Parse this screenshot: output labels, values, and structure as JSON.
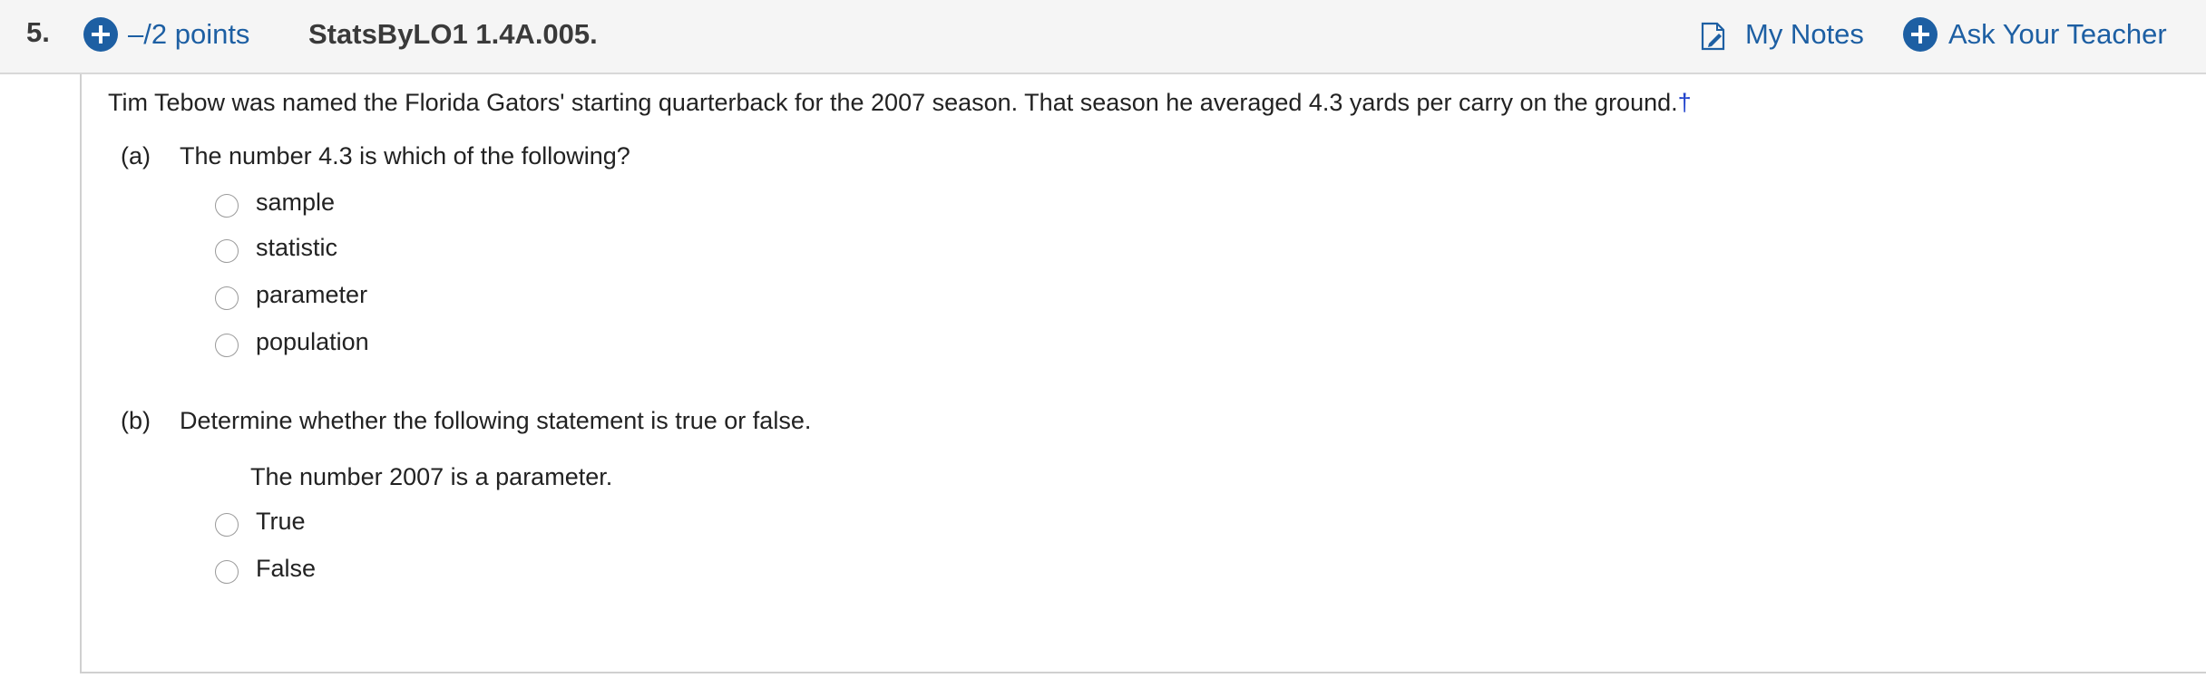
{
  "header": {
    "question_number": "5.",
    "points_label": "–/2 points",
    "question_id": "StatsByLO1 1.4A.005.",
    "my_notes_label": "My Notes",
    "ask_teacher_label": "Ask Your Teacher"
  },
  "question": {
    "stem": "Tim Tebow was named the Florida Gators' starting quarterback for the 2007 season. That season he averaged 4.3 yards per carry on the ground.",
    "footnote_marker": "†"
  },
  "part_a": {
    "label": "(a)",
    "prompt": "The number 4.3 is which of the following?",
    "options": [
      "sample",
      "statistic",
      "parameter",
      "population"
    ]
  },
  "part_b": {
    "label": "(b)",
    "prompt": "Determine whether the following statement is true or false.",
    "statement": "The number 2007 is a parameter.",
    "options": [
      "True",
      "False"
    ]
  },
  "colors": {
    "link_blue": "#1d5fa3",
    "footnote_blue": "#2244cc",
    "header_bg": "#f5f5f5"
  },
  "icons": {
    "points": "plus-circle-icon",
    "notes": "note-pencil-icon",
    "ask_teacher": "plus-circle-icon"
  }
}
